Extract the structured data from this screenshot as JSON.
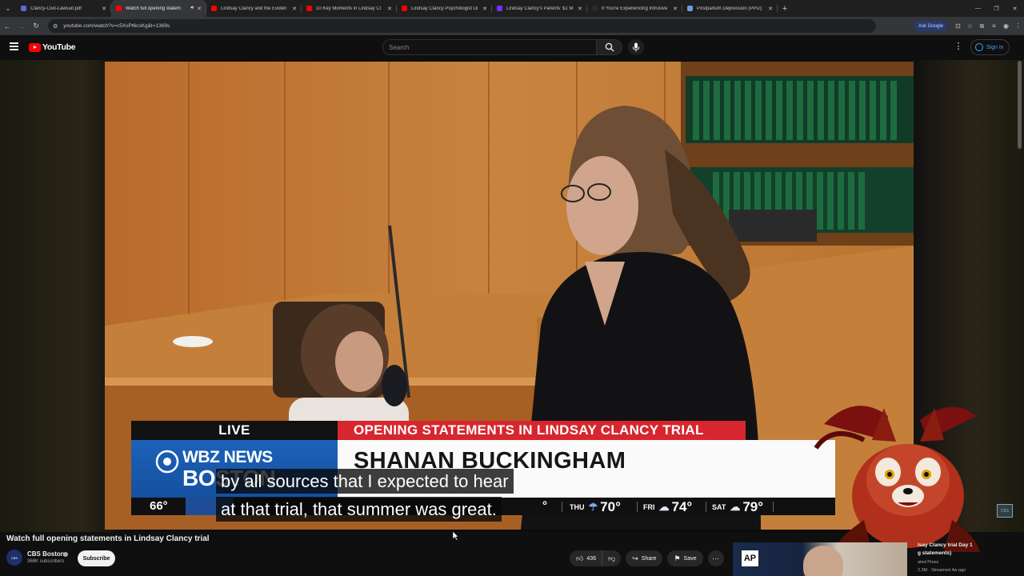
{
  "browser": {
    "tabs": [
      {
        "title": "Clancy-Civil-Lawsuit.pdf",
        "active": false,
        "fav_color": "#5b6bd6"
      },
      {
        "title": "Watch full opening statem",
        "active": true,
        "fav_color": "#ff0000"
      },
      {
        "title": "Lindsay Clancy and the Eviden",
        "active": false,
        "fav_color": "#ff0000"
      },
      {
        "title": "10 Key Moments in Lindsay Cl",
        "active": false,
        "fav_color": "#ff0000"
      },
      {
        "title": "Lindsay Clancy Psychologist Di",
        "active": false,
        "fav_color": "#ff0000"
      },
      {
        "title": "Lindsay Clancy's Parents' $1 M",
        "active": false,
        "fav_color": "#7b2cff"
      },
      {
        "title": "If You're Experiencing Intrusive",
        "active": false,
        "fav_color": "#2a2a2a"
      },
      {
        "title": "Postpartum Depression (PPD):",
        "active": false,
        "fav_color": "#6a9ee8"
      }
    ],
    "url": "youtube.com/watch?v=c5XvPt6csKg&t=1369s",
    "ask_google": "Ask Google"
  },
  "masthead": {
    "logo_text": "YouTube",
    "search_placeholder": "Search",
    "sign_in": "Sign in"
  },
  "video": {
    "lower_third": {
      "live": "LIVE",
      "banner": "OPENING STATEMENTS IN LINDSAY CLANCY TRIAL",
      "station_line1": "WBZ NEWS",
      "station_line2": "BOSTON",
      "name": "SHANAN BUCKINGHAM"
    },
    "weather": {
      "current": "66°",
      "days": [
        {
          "day": "THU",
          "icon": "rain-cloud-icon",
          "temp": "70°"
        },
        {
          "day": "FRI",
          "icon": "rain-cloud-icon",
          "temp": "74°"
        },
        {
          "day": "SAT",
          "icon": "sun-cloud-icon",
          "temp": "79°"
        }
      ],
      "hidden_temp": "°"
    },
    "captions": [
      "by all sources that I expected to hear",
      "at that trial, that summer was great."
    ],
    "corner_bug": "CBS"
  },
  "details": {
    "title": "Watch full opening statements in Lindsay Clancy trial",
    "channel": "CBS Boston",
    "avatar_text": "CBS",
    "subscribers": "368K subscribers",
    "subscribe": "Subscribe",
    "likes": "436",
    "share": "Share",
    "save": "Save"
  },
  "recommendation": {
    "badge": "AP",
    "title_line1": "lsay Clancy trial Day 1",
    "title_line2": "g statements)",
    "channel": "ated Press",
    "meta": "2.3M · Streamed 4w ago"
  },
  "colors": {
    "youtube_red": "#ff0000",
    "banner_red": "#d7262e",
    "station_blue": "#1c62b8",
    "link_blue": "#3ea6ff"
  }
}
